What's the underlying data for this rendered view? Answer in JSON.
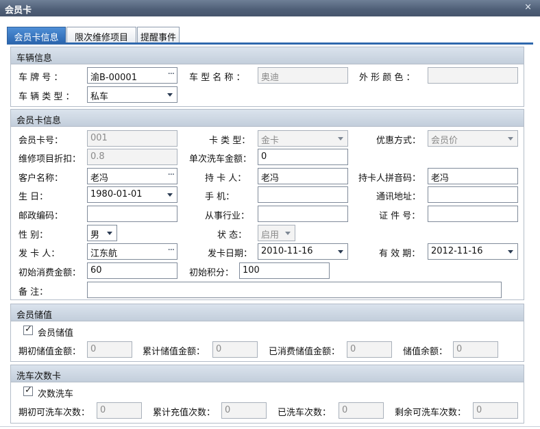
{
  "window": {
    "title": "会员卡",
    "close_glyph": "×"
  },
  "tabs": [
    {
      "label": "会员卡信息",
      "active": true
    },
    {
      "label": "限次维修项目",
      "active": false
    },
    {
      "label": "提醒事件",
      "active": false
    }
  ],
  "vehicle": {
    "header": "车辆信息",
    "plate": {
      "label": "车 牌 号 ：",
      "value": "渝B-00001"
    },
    "model": {
      "label": "车 型 名 称 ：",
      "value": "奥迪"
    },
    "color": {
      "label": "外 形 颜 色 ：",
      "value": ""
    },
    "type": {
      "label": "车 辆 类 型 ：",
      "value": "私车"
    }
  },
  "card": {
    "header": "会员卡信息",
    "card_no": {
      "label": "会员卡号：",
      "value": "001"
    },
    "card_type": {
      "label": "卡 类 型：",
      "value": "金卡"
    },
    "discount_mode": {
      "label": "优惠方式：",
      "value": "会员价"
    },
    "repair_discount": {
      "label": "维修项目折扣：",
      "value": "0.8"
    },
    "wash_amount": {
      "label": "单次洗车金额：",
      "value": "0"
    },
    "customer": {
      "label": "客户名称：",
      "value": "老冯"
    },
    "holder": {
      "label": "持 卡 人：",
      "value": "老冯"
    },
    "holder_pinyin": {
      "label": "持卡人拼音码：",
      "value": "老冯"
    },
    "birthday": {
      "label": "生      日：",
      "value": "1980-01-01"
    },
    "mobile": {
      "label": "手      机：",
      "value": ""
    },
    "address": {
      "label": "通讯地址：",
      "value": ""
    },
    "postcode": {
      "label": "邮政编码：",
      "value": ""
    },
    "industry": {
      "label": "从事行业：",
      "value": ""
    },
    "id_no": {
      "label": "证 件 号：",
      "value": ""
    },
    "gender": {
      "label": "性      别：",
      "value": "男"
    },
    "status": {
      "label": "状      态：",
      "value": "启用"
    },
    "issuer": {
      "label": "发 卡 人：",
      "value": "江东航"
    },
    "issue_date": {
      "label": "发卡日期：",
      "value": "2010-11-16"
    },
    "expiry": {
      "label": "有 效 期：",
      "value": "2012-11-16"
    },
    "initial_amount": {
      "label": "初始消费金额：",
      "value": "60"
    },
    "initial_points": {
      "label": "初始积分：",
      "value": "100"
    },
    "remark": {
      "label": "备      注：",
      "value": ""
    }
  },
  "stored_value": {
    "header": "会员储值",
    "checkbox_label": "会员储值",
    "checked": true,
    "opening": {
      "label": "期初储值金额：",
      "value": "0"
    },
    "accumulated": {
      "label": "累计储值金额：",
      "value": "0"
    },
    "consumed": {
      "label": "已消费储值金额：",
      "value": "0"
    },
    "balance": {
      "label": "储值余额：",
      "value": "0"
    }
  },
  "wash_count": {
    "header": "洗车次数卡",
    "checkbox_label": "次数洗车",
    "checked": true,
    "opening": {
      "label": "期初可洗车次数：",
      "value": "0"
    },
    "recharged": {
      "label": "累计充值次数：",
      "value": "0"
    },
    "washed": {
      "label": "已洗车次数：",
      "value": "0"
    },
    "remaining": {
      "label": "剩余可洗车次数：",
      "value": "0"
    }
  }
}
